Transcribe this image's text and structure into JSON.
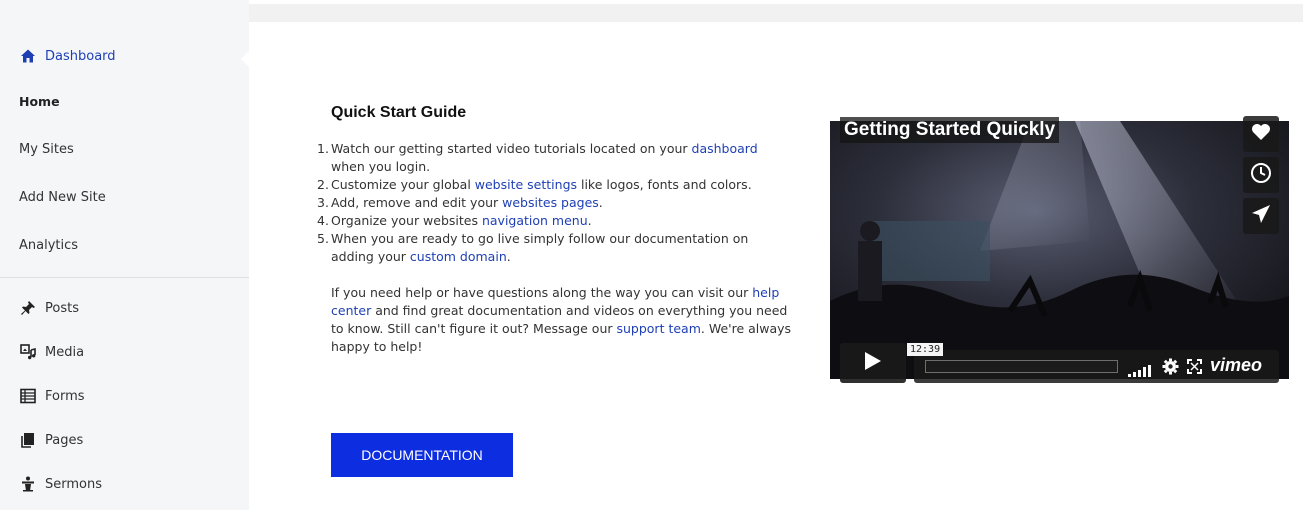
{
  "sidebar": {
    "items": [
      {
        "label": "Dashboard",
        "icon": "home-icon"
      },
      {
        "label": "Home"
      },
      {
        "label": "My Sites"
      },
      {
        "label": "Add New Site"
      },
      {
        "label": "Analytics"
      },
      {
        "label": "Posts",
        "icon": "pin-icon"
      },
      {
        "label": "Media",
        "icon": "media-icon"
      },
      {
        "label": "Forms",
        "icon": "forms-icon"
      },
      {
        "label": "Pages",
        "icon": "pages-icon"
      },
      {
        "label": "Sermons",
        "icon": "sermons-icon"
      }
    ],
    "active_color": "#1e3fb4"
  },
  "guide": {
    "title": "Quick Start Guide",
    "steps": [
      {
        "num": "1.",
        "before": "Watch our getting started video tutorials located on your ",
        "link": "dashboard",
        "after": " when you login."
      },
      {
        "num": "2.",
        "before": "Customize your global ",
        "link": "website settings",
        "after": " like logos, fonts and colors."
      },
      {
        "num": "3.",
        "before": "Add, remove and edit your ",
        "link": "websites pages",
        "after": "."
      },
      {
        "num": "4.",
        "before": "Organize your websites ",
        "link": "navigation menu",
        "after": "."
      },
      {
        "num": "5.",
        "before": "When you are ready to go live simply follow our documentation on adding your ",
        "link": "custom domain",
        "after": "."
      }
    ],
    "help": {
      "before": "If you need help or have questions along the way you can visit our ",
      "link1": "help center",
      "middle": " and find great documentation and videos on everything you need to know. Still can't figure it out? Message our ",
      "link2": "support team",
      "after": ". We're always happy to help!"
    },
    "button_label": "DOCUMENTATION",
    "button_color": "#0d2de0"
  },
  "video": {
    "title": "Getting Started Quickly",
    "timecode": "12:39",
    "brand": "vimeo",
    "buttons": [
      "heart-icon",
      "clock-icon",
      "send-icon"
    ],
    "controls": [
      "play-icon",
      "volume-icon",
      "settings-icon",
      "fullscreen-icon"
    ]
  }
}
